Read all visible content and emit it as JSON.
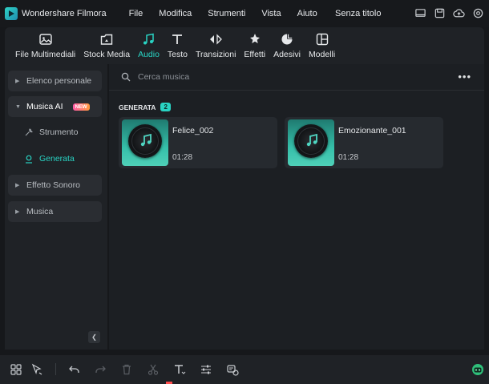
{
  "app": {
    "name": "Wondershare Filmora",
    "doc_title": "Senza titolo"
  },
  "menu": [
    "File",
    "Modifica",
    "Strumenti",
    "Vista",
    "Aiuto"
  ],
  "toolbar": [
    {
      "label": "File Multimediali",
      "icon": "media-icon"
    },
    {
      "label": "Stock Media",
      "icon": "stock-icon"
    },
    {
      "label": "Audio",
      "icon": "music-note-icon",
      "active": true
    },
    {
      "label": "Testo",
      "icon": "text-icon"
    },
    {
      "label": "Transizioni",
      "icon": "transition-icon"
    },
    {
      "label": "Effetti",
      "icon": "effects-icon"
    },
    {
      "label": "Adesivi",
      "icon": "sticker-icon"
    },
    {
      "label": "Modelli",
      "icon": "templates-icon"
    }
  ],
  "sidebar": {
    "items": [
      {
        "label": "Elenco personale"
      },
      {
        "label": "Musica AI",
        "badge": "NEW",
        "expanded": true
      },
      {
        "label": "Strumento"
      },
      {
        "label": "Generata",
        "active": true
      },
      {
        "label": "Effetto Sonoro"
      },
      {
        "label": "Musica"
      }
    ]
  },
  "search": {
    "placeholder": "Cerca musica"
  },
  "section": {
    "label": "GENERATA",
    "count": "2"
  },
  "tracks": [
    {
      "name": "Felice_002",
      "duration": "01:28"
    },
    {
      "name": "Emozionante_001",
      "duration": "01:28"
    }
  ],
  "colors": {
    "accent": "#29d3c3",
    "panel": "#1f2226",
    "background": "#16181b"
  }
}
